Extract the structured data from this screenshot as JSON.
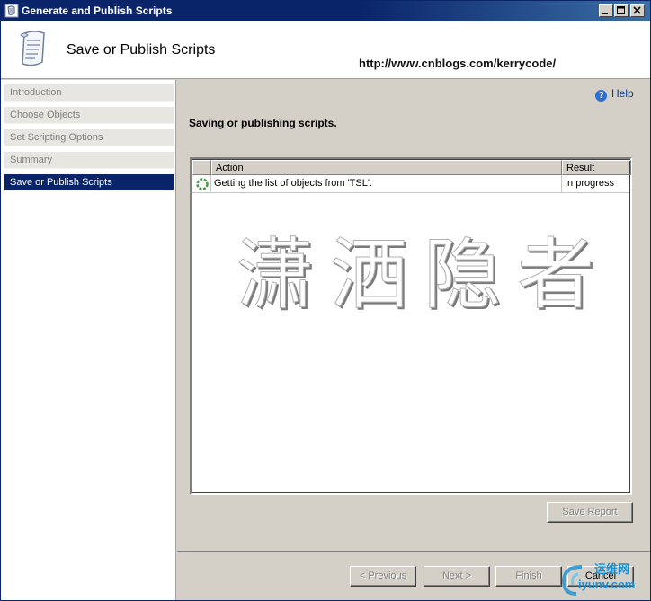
{
  "window": {
    "title": "Generate and Publish Scripts",
    "controls": [
      "minimize",
      "maximize",
      "close"
    ]
  },
  "header": {
    "heading": "Save or Publish Scripts",
    "url": "http://www.cnblogs.com/kerrycode/"
  },
  "nav": {
    "items": [
      {
        "label": "Introduction",
        "active": false
      },
      {
        "label": "Choose Objects",
        "active": false
      },
      {
        "label": "Set Scripting Options",
        "active": false
      },
      {
        "label": "Summary",
        "active": false
      },
      {
        "label": "Save or Publish Scripts",
        "active": true
      }
    ]
  },
  "main": {
    "help_label": "Help",
    "status_heading": "Saving or publishing scripts.",
    "grid": {
      "columns": [
        "Action",
        "Result"
      ],
      "rows": [
        {
          "action": "Getting the list of objects from 'TSL'.",
          "result": "In progress",
          "icon": "spinner-icon"
        }
      ]
    },
    "save_report_label": "Save Report"
  },
  "footer": {
    "previous_label": "< Previous",
    "next_label": "Next >",
    "finish_label": "Finish",
    "cancel_label": "Cancel"
  },
  "overlay": {
    "watermark_text": "潇洒隐者",
    "logo_top": "运维网",
    "logo_bottom": "iyunv.com"
  },
  "colors": {
    "titlebar": "#0a246a",
    "nav_active": "#0a246a",
    "panel": "#d4d0c8",
    "help_link": "#0a3a94"
  }
}
